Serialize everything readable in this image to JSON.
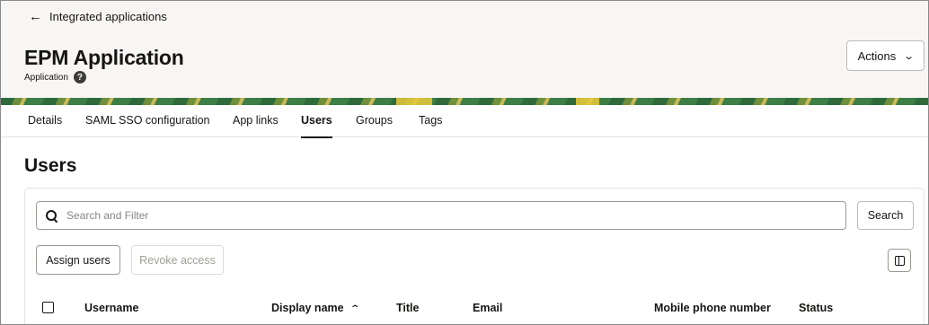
{
  "header": {
    "back_label": "Integrated applications",
    "back_arrow": "←",
    "title": "EPM Application",
    "subtitle": "Application",
    "help_glyph": "?",
    "actions_label": "Actions"
  },
  "tabs": [
    {
      "label": "Details",
      "active": false
    },
    {
      "label": "SAML SSO configuration",
      "active": false
    },
    {
      "label": "App links",
      "active": false
    },
    {
      "label": "Users",
      "active": true
    },
    {
      "label": "Groups",
      "active": false
    },
    {
      "label": "Tags",
      "active": false
    }
  ],
  "users": {
    "title": "Users",
    "search": {
      "placeholder": "Search and Filter",
      "value": ""
    },
    "search_button": "Search",
    "assign_button": "Assign users",
    "revoke_button": "Revoke access",
    "columns": [
      {
        "label": "Username"
      },
      {
        "label": "Display name",
        "sorted": "ascending"
      },
      {
        "label": "Title"
      },
      {
        "label": "Email"
      },
      {
        "label": "Mobile phone number"
      },
      {
        "label": "Status"
      }
    ]
  },
  "icons": {
    "back": "arrow-left-icon",
    "help": "help-circle-icon",
    "actions": "chevron-down-icon",
    "search": "search-icon",
    "columns": "column-toggle-icon",
    "sort": "sort-ascending-icon"
  },
  "colors": {
    "text": "#161513",
    "header_bg": "#f7f6f5",
    "border": "#bcbab6",
    "disabled_text": "#a09c97",
    "banner_green": "#2f6b3a",
    "banner_yellow": "#e8c93a"
  }
}
